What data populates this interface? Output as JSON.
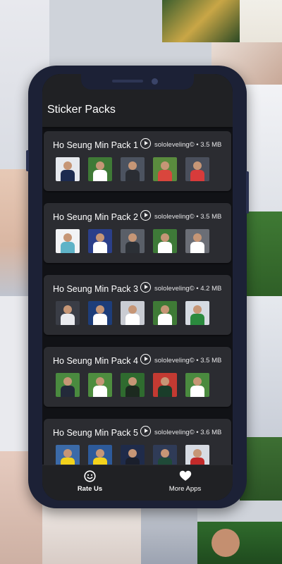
{
  "app": {
    "title": "Sticker Packs"
  },
  "colors": {
    "phone_frame": "#1c2136",
    "app_bar": "#202124",
    "card": "#2b2c31",
    "screen_bg": "#111216",
    "text": "#ffffff"
  },
  "packs": [
    {
      "name": "Ho Seung Min Pack 1",
      "meta": "sololeveling© • 3.5 MB",
      "thumbs": [
        {
          "bg": "#e6e9ee",
          "shirt": "#1d2b4f"
        },
        {
          "bg": "#3f7a36",
          "shirt": "#ffffff"
        },
        {
          "bg": "#4c5360",
          "shirt": "#2a2d33"
        },
        {
          "bg": "#5a8b3e",
          "shirt": "#d9463d"
        },
        {
          "bg": "#4a4f5c",
          "shirt": "#d83b3b"
        }
      ]
    },
    {
      "name": "Ho Seung Min Pack 2",
      "meta": "sololeveling© • 3.5 MB",
      "thumbs": [
        {
          "bg": "#f2f3f5",
          "shirt": "#5fb3c7"
        },
        {
          "bg": "#2b3f8a",
          "shirt": "#ffffff"
        },
        {
          "bg": "#5a5f68",
          "shirt": "#2c3036"
        },
        {
          "bg": "#3e7a38",
          "shirt": "#ffffff"
        },
        {
          "bg": "#6b6e76",
          "shirt": "#ffffff"
        }
      ]
    },
    {
      "name": "Ho Seung Min Pack 3",
      "meta": "sololeveling© • 4.2 MB",
      "thumbs": [
        {
          "bg": "#3a3d46",
          "shirt": "#e9eaee"
        },
        {
          "bg": "#1d3d7a",
          "shirt": "#ffffff"
        },
        {
          "bg": "#c9ccd3",
          "shirt": "#ffffff"
        },
        {
          "bg": "#3f7a36",
          "shirt": "#ffffff"
        },
        {
          "bg": "#d6dbe2",
          "shirt": "#2b8a3e"
        }
      ]
    },
    {
      "name": "Ho Seung Min Pack 4",
      "meta": "sololeveling© • 3.5 MB",
      "thumbs": [
        {
          "bg": "#4a8a3f",
          "shirt": "#232a3a"
        },
        {
          "bg": "#4e8d3f",
          "shirt": "#ffffff"
        },
        {
          "bg": "#2f6b2f",
          "shirt": "#1c2a1f"
        },
        {
          "bg": "#c33a32",
          "shirt": "#1a3d2a"
        },
        {
          "bg": "#4a8a3f",
          "shirt": "#ffffff"
        }
      ]
    },
    {
      "name": "Ho Seung Min Pack 5",
      "meta": "sololeveling© • 3.6 MB",
      "thumbs": [
        {
          "bg": "#3b6aa8",
          "shirt": "#f2d21c"
        },
        {
          "bg": "#2d5a9a",
          "shirt": "#f2d21c"
        },
        {
          "bg": "#1f2b4a",
          "shirt": "#1a1f2c"
        },
        {
          "bg": "#2f3b57",
          "shirt": "#1f4a38"
        },
        {
          "bg": "#d7dbe3",
          "shirt": "#c22a2a"
        }
      ]
    }
  ],
  "nav": {
    "rate": {
      "label": "Rate Us",
      "icon": "smiley-icon"
    },
    "more": {
      "label": "More Apps",
      "icon": "heart-icon"
    }
  }
}
